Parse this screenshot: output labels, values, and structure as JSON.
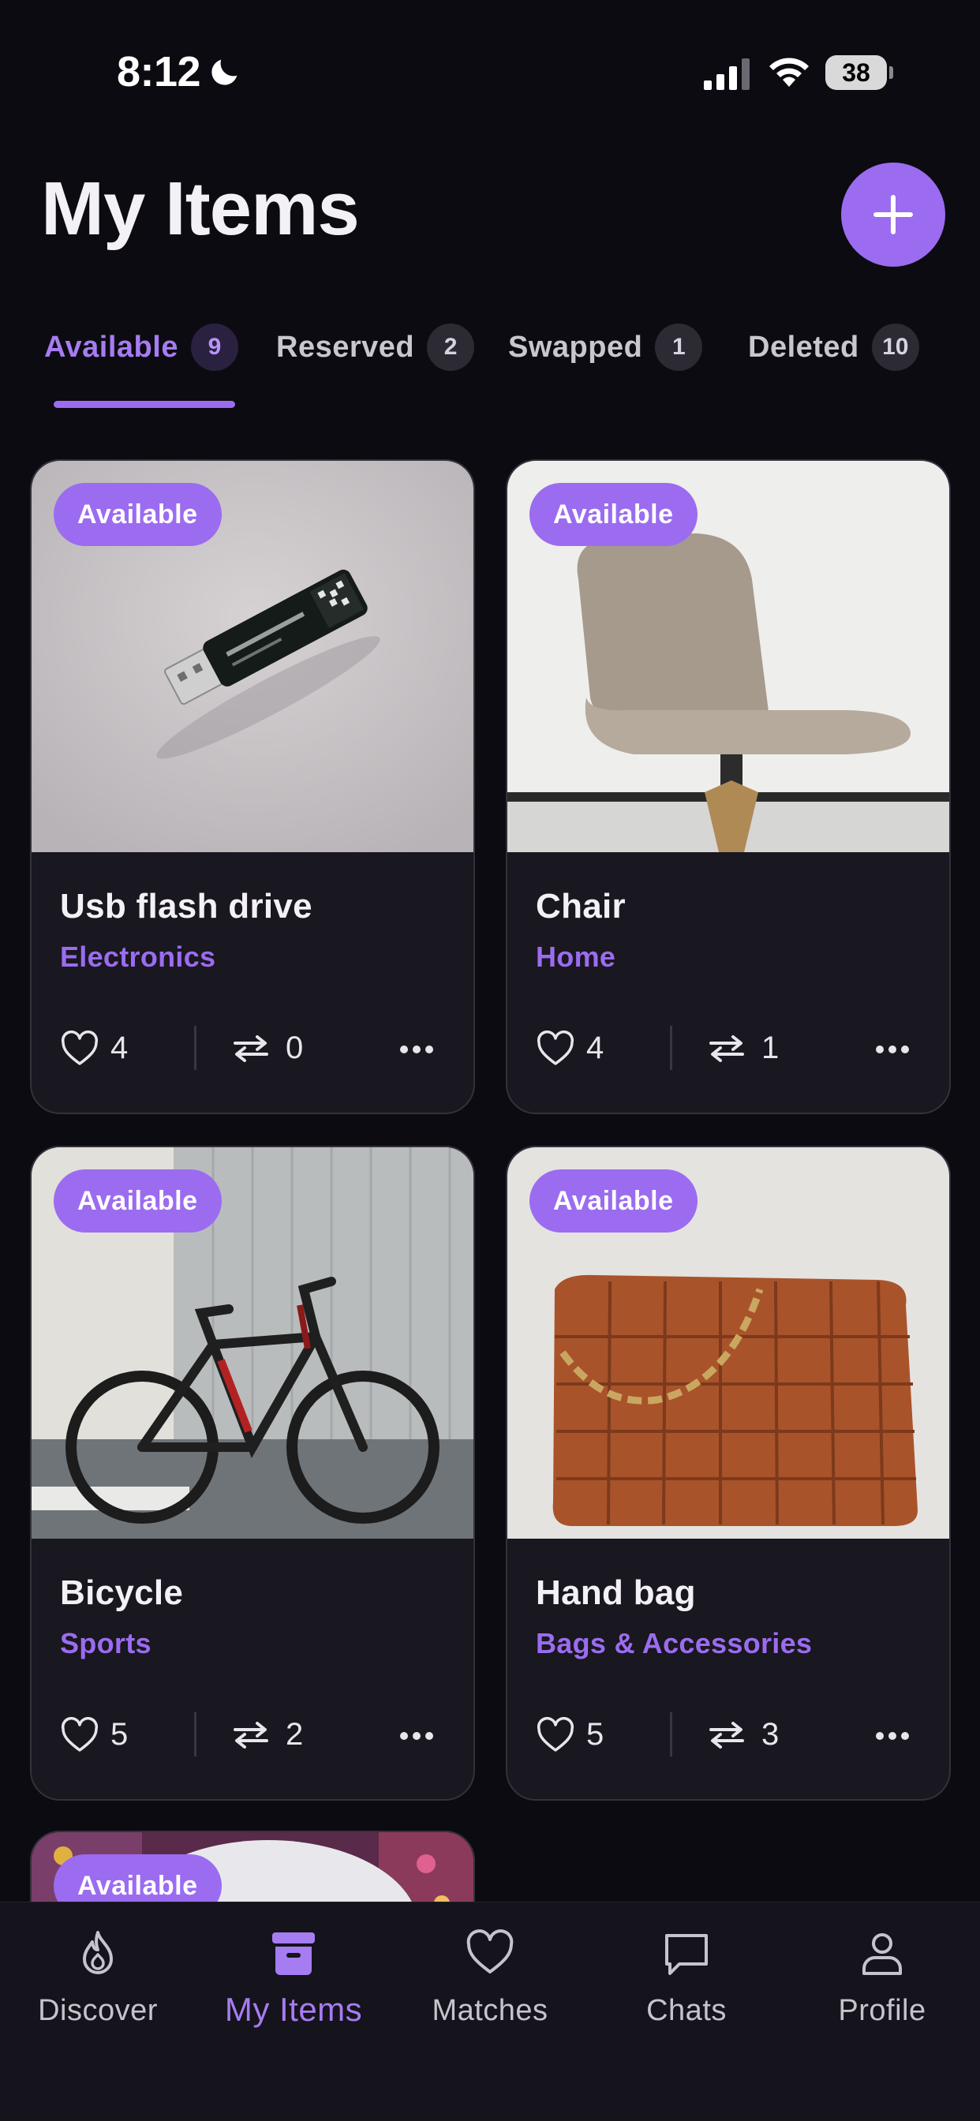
{
  "status_bar": {
    "time": "8:12",
    "battery": "38"
  },
  "header": {
    "title": "My Items"
  },
  "tabs": [
    {
      "label": "Available",
      "count": "9",
      "active": true
    },
    {
      "label": "Reserved",
      "count": "2"
    },
    {
      "label": "Swapped",
      "count": "1"
    },
    {
      "label": "Deleted",
      "count": "10"
    }
  ],
  "items": [
    {
      "status": "Available",
      "title": "Usb flash drive",
      "category": "Electronics",
      "likes": "4",
      "swaps": "0"
    },
    {
      "status": "Available",
      "title": "Chair",
      "category": "Home",
      "likes": "4",
      "swaps": "1"
    },
    {
      "status": "Available",
      "title": "Bicycle",
      "category": "Sports",
      "likes": "5",
      "swaps": "2"
    },
    {
      "status": "Available",
      "title": "Hand bag",
      "category": "Bags & Accessories",
      "likes": "5",
      "swaps": "3"
    },
    {
      "status": "Available"
    }
  ],
  "nav": [
    {
      "label": "Discover",
      "icon": "flame-icon"
    },
    {
      "label": "My Items",
      "icon": "archive-box-icon",
      "active": true
    },
    {
      "label": "Matches",
      "icon": "heart-icon"
    },
    {
      "label": "Chats",
      "icon": "chat-bubble-icon"
    },
    {
      "label": "Profile",
      "icon": "person-icon"
    }
  ],
  "colors": {
    "accent": "#9b6cf0",
    "background": "#0c0b11",
    "card": "#19171f"
  }
}
